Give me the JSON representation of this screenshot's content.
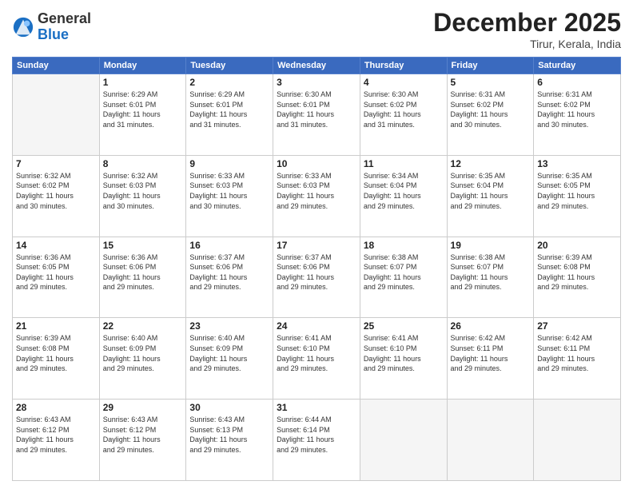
{
  "header": {
    "logo_general": "General",
    "logo_blue": "Blue",
    "month_year": "December 2025",
    "location": "Tirur, Kerala, India"
  },
  "days_of_week": [
    "Sunday",
    "Monday",
    "Tuesday",
    "Wednesday",
    "Thursday",
    "Friday",
    "Saturday"
  ],
  "weeks": [
    [
      {
        "day": "",
        "empty": true
      },
      {
        "day": "1",
        "sunrise": "6:29 AM",
        "sunset": "6:01 PM",
        "daylight": "11 hours and 31 minutes."
      },
      {
        "day": "2",
        "sunrise": "6:29 AM",
        "sunset": "6:01 PM",
        "daylight": "11 hours and 31 minutes."
      },
      {
        "day": "3",
        "sunrise": "6:30 AM",
        "sunset": "6:01 PM",
        "daylight": "11 hours and 31 minutes."
      },
      {
        "day": "4",
        "sunrise": "6:30 AM",
        "sunset": "6:02 PM",
        "daylight": "11 hours and 31 minutes."
      },
      {
        "day": "5",
        "sunrise": "6:31 AM",
        "sunset": "6:02 PM",
        "daylight": "11 hours and 30 minutes."
      },
      {
        "day": "6",
        "sunrise": "6:31 AM",
        "sunset": "6:02 PM",
        "daylight": "11 hours and 30 minutes."
      }
    ],
    [
      {
        "day": "7",
        "sunrise": "6:32 AM",
        "sunset": "6:02 PM",
        "daylight": "11 hours and 30 minutes."
      },
      {
        "day": "8",
        "sunrise": "6:32 AM",
        "sunset": "6:03 PM",
        "daylight": "11 hours and 30 minutes."
      },
      {
        "day": "9",
        "sunrise": "6:33 AM",
        "sunset": "6:03 PM",
        "daylight": "11 hours and 30 minutes."
      },
      {
        "day": "10",
        "sunrise": "6:33 AM",
        "sunset": "6:03 PM",
        "daylight": "11 hours and 29 minutes."
      },
      {
        "day": "11",
        "sunrise": "6:34 AM",
        "sunset": "6:04 PM",
        "daylight": "11 hours and 29 minutes."
      },
      {
        "day": "12",
        "sunrise": "6:35 AM",
        "sunset": "6:04 PM",
        "daylight": "11 hours and 29 minutes."
      },
      {
        "day": "13",
        "sunrise": "6:35 AM",
        "sunset": "6:05 PM",
        "daylight": "11 hours and 29 minutes."
      }
    ],
    [
      {
        "day": "14",
        "sunrise": "6:36 AM",
        "sunset": "6:05 PM",
        "daylight": "11 hours and 29 minutes."
      },
      {
        "day": "15",
        "sunrise": "6:36 AM",
        "sunset": "6:06 PM",
        "daylight": "11 hours and 29 minutes."
      },
      {
        "day": "16",
        "sunrise": "6:37 AM",
        "sunset": "6:06 PM",
        "daylight": "11 hours and 29 minutes."
      },
      {
        "day": "17",
        "sunrise": "6:37 AM",
        "sunset": "6:06 PM",
        "daylight": "11 hours and 29 minutes."
      },
      {
        "day": "18",
        "sunrise": "6:38 AM",
        "sunset": "6:07 PM",
        "daylight": "11 hours and 29 minutes."
      },
      {
        "day": "19",
        "sunrise": "6:38 AM",
        "sunset": "6:07 PM",
        "daylight": "11 hours and 29 minutes."
      },
      {
        "day": "20",
        "sunrise": "6:39 AM",
        "sunset": "6:08 PM",
        "daylight": "11 hours and 29 minutes."
      }
    ],
    [
      {
        "day": "21",
        "sunrise": "6:39 AM",
        "sunset": "6:08 PM",
        "daylight": "11 hours and 29 minutes."
      },
      {
        "day": "22",
        "sunrise": "6:40 AM",
        "sunset": "6:09 PM",
        "daylight": "11 hours and 29 minutes."
      },
      {
        "day": "23",
        "sunrise": "6:40 AM",
        "sunset": "6:09 PM",
        "daylight": "11 hours and 29 minutes."
      },
      {
        "day": "24",
        "sunrise": "6:41 AM",
        "sunset": "6:10 PM",
        "daylight": "11 hours and 29 minutes."
      },
      {
        "day": "25",
        "sunrise": "6:41 AM",
        "sunset": "6:10 PM",
        "daylight": "11 hours and 29 minutes."
      },
      {
        "day": "26",
        "sunrise": "6:42 AM",
        "sunset": "6:11 PM",
        "daylight": "11 hours and 29 minutes."
      },
      {
        "day": "27",
        "sunrise": "6:42 AM",
        "sunset": "6:11 PM",
        "daylight": "11 hours and 29 minutes."
      }
    ],
    [
      {
        "day": "28",
        "sunrise": "6:43 AM",
        "sunset": "6:12 PM",
        "daylight": "11 hours and 29 minutes."
      },
      {
        "day": "29",
        "sunrise": "6:43 AM",
        "sunset": "6:12 PM",
        "daylight": "11 hours and 29 minutes."
      },
      {
        "day": "30",
        "sunrise": "6:43 AM",
        "sunset": "6:13 PM",
        "daylight": "11 hours and 29 minutes."
      },
      {
        "day": "31",
        "sunrise": "6:44 AM",
        "sunset": "6:14 PM",
        "daylight": "11 hours and 29 minutes."
      },
      {
        "day": "",
        "empty": true
      },
      {
        "day": "",
        "empty": true
      },
      {
        "day": "",
        "empty": true
      }
    ]
  ],
  "labels": {
    "sunrise_prefix": "Sunrise: ",
    "sunset_prefix": "Sunset: ",
    "daylight_prefix": "Daylight: "
  }
}
